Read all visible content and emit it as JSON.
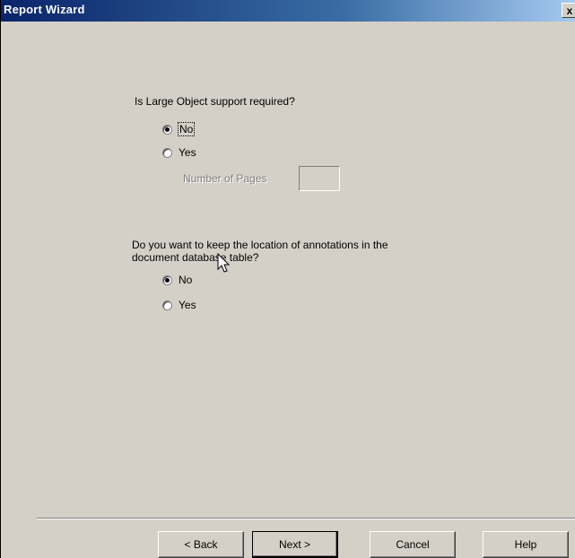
{
  "window": {
    "title": "Report Wizard",
    "close_glyph": "x"
  },
  "lob": {
    "question": "Is Large Object support required?",
    "options": [
      {
        "label": "No",
        "selected": true
      },
      {
        "label": "Yes",
        "selected": false
      }
    ],
    "pages_label": "Number of Pages",
    "pages_value": ""
  },
  "annot": {
    "question_line1": "Do you want to keep the location of annotations in the",
    "question_line2": "document database table?",
    "options": [
      {
        "label": "No",
        "selected": true
      },
      {
        "label": "Yes",
        "selected": false
      }
    ]
  },
  "buttons": {
    "back": "< Back",
    "next": "Next >",
    "cancel": "Cancel",
    "help": "Help"
  },
  "icons": {
    "close": "close-icon",
    "cursor": "mouse-pointer-icon"
  }
}
